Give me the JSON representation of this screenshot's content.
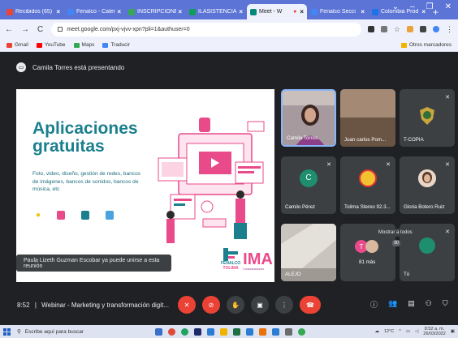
{
  "browser": {
    "tabs": [
      {
        "label": "Recibidos (65)",
        "color": "#ea4335",
        "active": false
      },
      {
        "label": "Fenalco - Calen",
        "color": "#4285f4",
        "active": false
      },
      {
        "label": "INSCRIPCIONES",
        "color": "#34a853",
        "active": false
      },
      {
        "label": "ILASISTENCIA",
        "color": "#0f9d58",
        "active": false
      },
      {
        "label": "Meet - W",
        "color": "#00897b",
        "active": true
      },
      {
        "label": "Fenalco Secci",
        "color": "#4285f4",
        "active": false
      },
      {
        "label": "Colombia Prod",
        "color": "#1a73e8",
        "active": false
      }
    ],
    "new_tab": "+",
    "window_controls": [
      "⌄",
      "–",
      "❐",
      "✕"
    ],
    "url": "meet.google.com/pxj-vjvv-xpn?pli=1&authuser=0"
  },
  "bookmarks": {
    "items": [
      {
        "label": "Gmail",
        "color": "#ea4335"
      },
      {
        "label": "YouTube",
        "color": "#ff0000"
      },
      {
        "label": "Maps",
        "color": "#34a853"
      },
      {
        "label": "Traducir",
        "color": "#4285f4"
      }
    ],
    "other": "Otros marcadores"
  },
  "meet": {
    "presenting": "Camila Torres está presentando",
    "slide": {
      "title": "Aplicaciones gratuitas",
      "body": "Foto, video, diseño, gestión de redes, bancos de imágenes, bancos de sonidos, bancos de música, etc",
      "logo_left": "FENALCO",
      "logo_left_sub": "TOLIMA",
      "logo_right": "IMA",
      "logo_right_sub": "Comunicaciones"
    },
    "toast": "Paula Lizeth Guzman Escobar ya puede unirse a esta reunión",
    "participants": [
      {
        "name": "Camila Torres",
        "type": "video"
      },
      {
        "name": "Juan carlos Pom...",
        "type": "video"
      },
      {
        "name": "T-COPIA",
        "type": "logo"
      },
      {
        "name": "Camilo Pérez",
        "type": "letter",
        "letter": "C"
      },
      {
        "name": "Tolima Stereo 92.3...",
        "type": "logo"
      },
      {
        "name": "Gloria Botero Ruiz",
        "type": "avatar"
      },
      {
        "name": "ALEJO",
        "type": "video"
      },
      {
        "name": "81 más",
        "type": "more"
      },
      {
        "name": "Tú",
        "type": "self"
      }
    ],
    "time": "8:52",
    "meeting_title": "Webinar - Marketing y transformación digit...",
    "tooltip": "Mostrar a todos",
    "badge": "90"
  },
  "taskbar": {
    "search": "Escribe aquí para buscar",
    "weather": "12°C",
    "time": "8:52 a. m.",
    "date": "26/03/2022"
  }
}
